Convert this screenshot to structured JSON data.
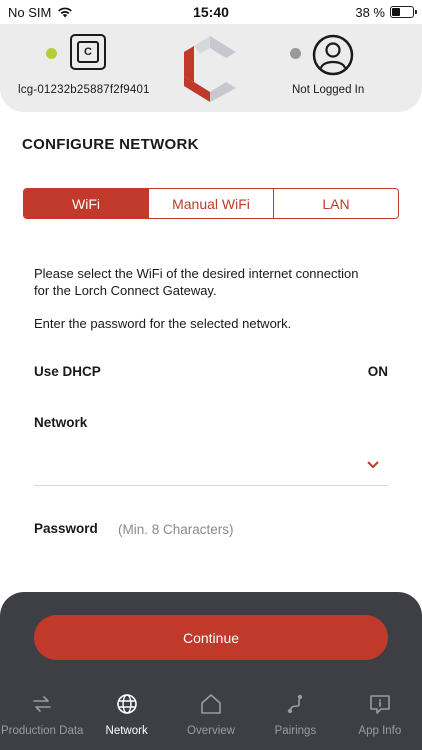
{
  "status_bar": {
    "carrier": "No SIM",
    "time": "15:40",
    "battery_text": "38 %",
    "battery_level": 0.38
  },
  "header": {
    "device_id": "lcg-01232b25887f2f9401",
    "device_status_color": "#b7cc3a",
    "user_status_color": "#999999",
    "user_status": "Not Logged In"
  },
  "page": {
    "title": "CONFIGURE NETWORK",
    "tabs": [
      {
        "label": "WiFi",
        "active": true
      },
      {
        "label": "Manual WiFi",
        "active": false
      },
      {
        "label": "LAN",
        "active": false
      }
    ],
    "intro": "Please select the WiFi of the desired internet connection for the Lorch Connect Gateway.",
    "password_hint": "Enter the password for the selected network.",
    "dhcp_label": "Use DHCP",
    "dhcp_value": "ON",
    "network_label": "Network",
    "network_value": "",
    "password_label": "Password",
    "password_placeholder": "(Min. 8 Characters)"
  },
  "actions": {
    "continue_label": "Continue"
  },
  "tabbar": {
    "items": [
      {
        "label": "Production Data",
        "icon": "arrows-swap-icon",
        "active": false
      },
      {
        "label": "Network",
        "icon": "globe-icon",
        "active": true
      },
      {
        "label": "Overview",
        "icon": "home-icon",
        "active": false
      },
      {
        "label": "Pairings",
        "icon": "pairing-icon",
        "active": false
      },
      {
        "label": "App Info",
        "icon": "info-bubble-icon",
        "active": false
      }
    ]
  },
  "colors": {
    "accent": "#c0392b",
    "panel": "#3d3f45",
    "header_bg": "#ececec"
  }
}
